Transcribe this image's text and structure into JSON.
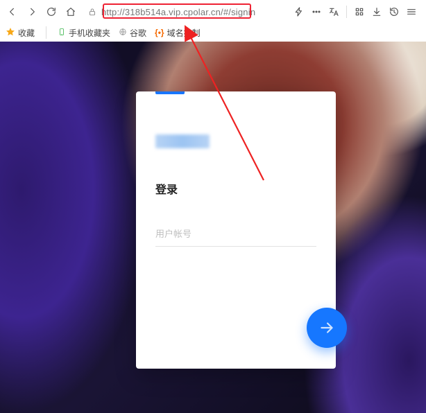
{
  "browser": {
    "url": "http://318b514a.vip.cpolar.cn/#/signin",
    "bookmarks": {
      "fav": "收藏",
      "mobile": "手机收藏夹",
      "google": "谷歌",
      "domain": "域名控制"
    }
  },
  "signin": {
    "title": "登录",
    "username_placeholder": "用户帐号"
  }
}
